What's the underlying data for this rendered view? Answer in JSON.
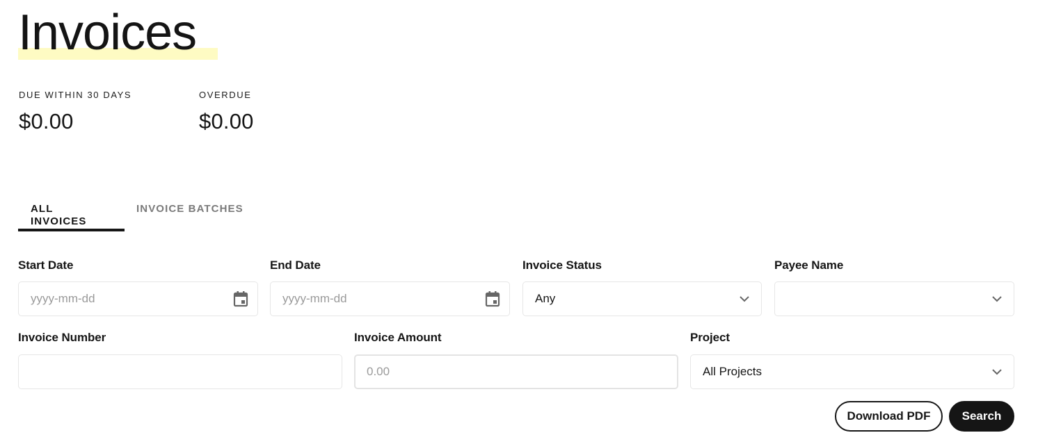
{
  "header": {
    "title": "Invoices"
  },
  "summary": {
    "due_within_30_days": {
      "label": "DUE WITHIN 30 DAYS",
      "value": "$0.00"
    },
    "overdue": {
      "label": "OVERDUE",
      "value": "$0.00"
    }
  },
  "tabs": [
    {
      "label": "ALL INVOICES",
      "active": true
    },
    {
      "label": "INVOICE BATCHES",
      "active": false
    }
  ],
  "filters": {
    "start_date": {
      "label": "Start Date",
      "value": "",
      "placeholder": "yyyy-mm-dd",
      "icon": "calendar-icon"
    },
    "end_date": {
      "label": "End Date",
      "value": "",
      "placeholder": "yyyy-mm-dd",
      "icon": "calendar-icon"
    },
    "invoice_status": {
      "label": "Invoice Status",
      "selected": "Any",
      "icon": "chevron-down-icon"
    },
    "payee_name": {
      "label": "Payee Name",
      "selected": "",
      "icon": "chevron-down-icon"
    },
    "invoice_number": {
      "label": "Invoice Number",
      "value": "",
      "placeholder": ""
    },
    "invoice_amount": {
      "label": "Invoice Amount",
      "value": "",
      "placeholder": "0.00"
    },
    "project": {
      "label": "Project",
      "selected": "All Projects",
      "icon": "chevron-down-icon"
    }
  },
  "actions": {
    "download_pdf_label": "Download PDF",
    "search_label": "Search"
  },
  "colors": {
    "title_highlight": "#fefbc3",
    "primary": "#151515",
    "inactive_tab": "#7a7a7a",
    "placeholder": "#9a9a9a",
    "border": "#e6e6e6"
  }
}
